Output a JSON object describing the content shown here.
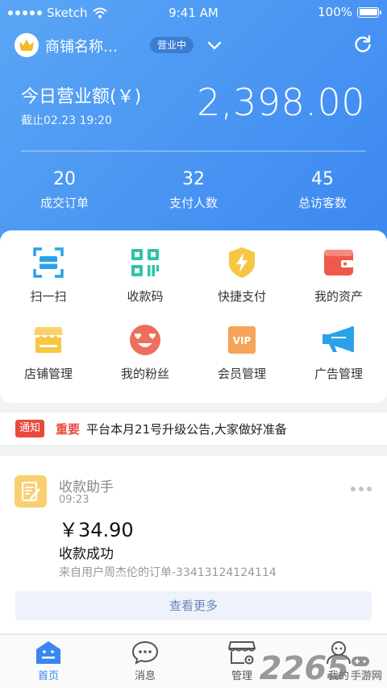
{
  "status_bar": {
    "carrier": "Sketch",
    "time": "9:41 AM",
    "battery": "100%"
  },
  "shop": {
    "name": "商铺名称…",
    "status_badge": "营业中"
  },
  "revenue": {
    "title": "今日营业额(￥)",
    "as_of": "截止02.23 19:20",
    "amount": "2,398.00"
  },
  "stats": [
    {
      "value": "20",
      "label": "成交订单"
    },
    {
      "value": "32",
      "label": "支付人数"
    },
    {
      "value": "45",
      "label": "总访客数"
    }
  ],
  "features": [
    {
      "label": "扫一扫",
      "icon": "scan-icon"
    },
    {
      "label": "收款码",
      "icon": "qrcode-icon"
    },
    {
      "label": "快捷支付",
      "icon": "quick-pay-icon"
    },
    {
      "label": "我的资产",
      "icon": "wallet-icon"
    },
    {
      "label": "店铺管理",
      "icon": "store-icon"
    },
    {
      "label": "我的粉丝",
      "icon": "fans-icon"
    },
    {
      "label": "会员管理",
      "icon": "vip-icon"
    },
    {
      "label": "广告管理",
      "icon": "megaphone-icon"
    }
  ],
  "colors": {
    "primary": "#3b86f0",
    "teal": "#2fc4a8",
    "yellow": "#f6c744",
    "red": "#e84a3c",
    "orange": "#f5a45a",
    "blue": "#2aa2e8"
  },
  "notice": {
    "tag": "通知",
    "important": "重要",
    "message": "平台本月21号升级公告,大家做好准备"
  },
  "assistant": {
    "title": "收款助手",
    "time": "09:23",
    "amount": "￥34.90",
    "result": "收款成功",
    "from": "来自用户周杰伦的订单-33413124124114",
    "more_button": "查看更多"
  },
  "tabs": [
    {
      "label": "首页",
      "icon": "home-icon"
    },
    {
      "label": "消息",
      "icon": "message-icon"
    },
    {
      "label": "管理",
      "icon": "manage-icon"
    },
    {
      "label": "我的",
      "icon": "profile-icon"
    }
  ],
  "watermark": {
    "number": "2265",
    "text": "手游网"
  }
}
